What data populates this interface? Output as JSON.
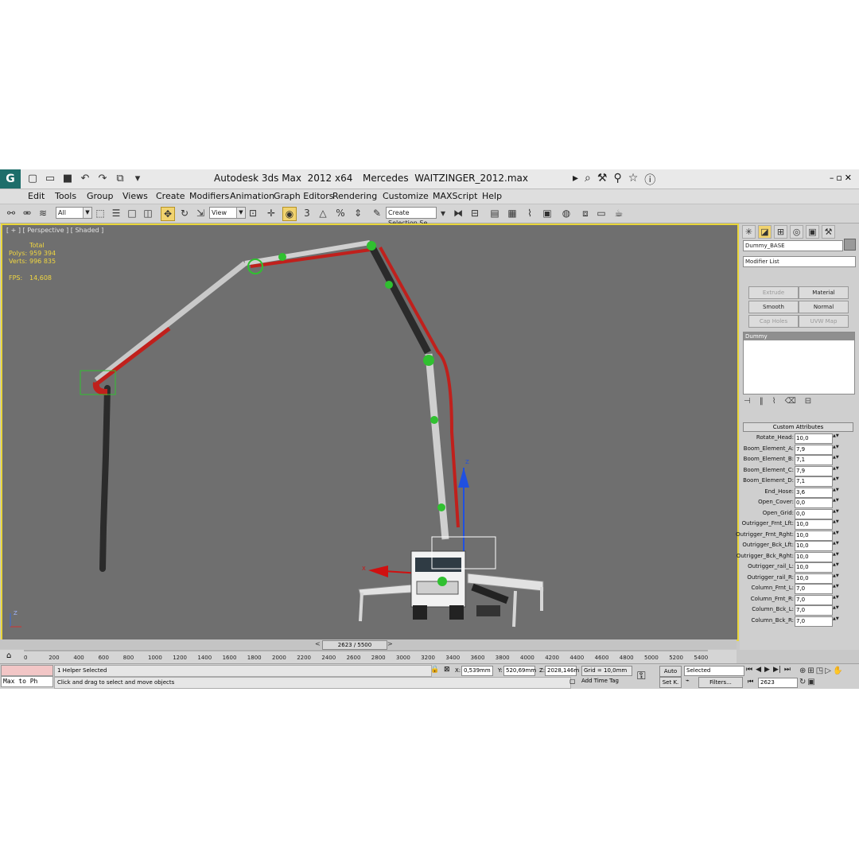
{
  "titlebar": {
    "app_title": "Autodesk 3ds Max  2012 x64",
    "file_title": "Mercedes  WAITZINGER_2012.max",
    "logo_icon": "3dsmax-logo-icon"
  },
  "menu": [
    "Edit",
    "Tools",
    "Group",
    "Views",
    "Create",
    "Modifiers",
    "Animation",
    "Graph Editors",
    "Rendering",
    "Customize",
    "MAXScript",
    "Help"
  ],
  "toolbar": {
    "filter_value": "All",
    "refcoord_value": "View",
    "selection_set_placeholder": "Create Selection Se"
  },
  "viewport": {
    "label": "[ + ] [ Perspective ] [ Shaded ]",
    "stats": {
      "total_label": "Total",
      "polys_label": "Polys:",
      "polys_value": "959 394",
      "verts_label": "Verts:",
      "verts_value": "996 835",
      "fps_label": "FPS:",
      "fps_value": "14,608"
    },
    "axis_z_label": "Z",
    "axis_x_label": "X",
    "corner_z": "Z"
  },
  "command_panel": {
    "object_name": "Dummy_BASE",
    "modifier_list": "Modifier List",
    "buttons": [
      {
        "label": "Extrude",
        "enabled": false
      },
      {
        "label": "Material",
        "enabled": true
      },
      {
        "label": "Smooth",
        "enabled": true
      },
      {
        "label": "Normal",
        "enabled": true
      },
      {
        "label": "Cap Holes",
        "enabled": false
      },
      {
        "label": "UVW Map",
        "enabled": false
      }
    ],
    "stack_item": "Dummy",
    "rollout_title": "Custom Attributes",
    "attributes": [
      {
        "label": "Rotate_Head:",
        "value": "10,0"
      },
      {
        "label": "Boom_Element_A:",
        "value": "7,9"
      },
      {
        "label": "Boom_Element_B:",
        "value": "7,1"
      },
      {
        "label": "Boom_Element_C:",
        "value": "7,9"
      },
      {
        "label": "Boom_Element_D:",
        "value": "7,1"
      },
      {
        "label": "End_Hose:",
        "value": "3,6"
      },
      {
        "label": "Open_Cover:",
        "value": "0,0"
      },
      {
        "label": "Open_Grid:",
        "value": "0,0"
      },
      {
        "label": "Outrigger_Frnt_Lft:",
        "value": "10,0"
      },
      {
        "label": "Outrigger_Frnt_Rght:",
        "value": "10,0"
      },
      {
        "label": "Outrigger_Bck_Lft:",
        "value": "10,0"
      },
      {
        "label": "Outrigger_Bck_Rght:",
        "value": "10,0"
      },
      {
        "label": "Outrigger_rail_L:",
        "value": "10,0"
      },
      {
        "label": "Outrigger_rail_R:",
        "value": "10,0"
      },
      {
        "label": "Column_Frnt_L:",
        "value": "7,0"
      },
      {
        "label": "Column_Frnt_R:",
        "value": "7,0"
      },
      {
        "label": "Column_Bck_L:",
        "value": "7,0"
      },
      {
        "label": "Column_Bck_R:",
        "value": "7,0"
      }
    ]
  },
  "timeline": {
    "slider_label": "2623 / 5500",
    "prev": "<",
    "next": ">",
    "ticks": [
      "0",
      "200",
      "400",
      "600",
      "800",
      "1000",
      "1200",
      "1400",
      "1600",
      "1800",
      "2000",
      "2200",
      "2400",
      "2600",
      "2800",
      "3000",
      "3200",
      "3400",
      "3600",
      "3800",
      "4000",
      "4200",
      "4400",
      "4600",
      "4800",
      "5000",
      "5200",
      "5400"
    ]
  },
  "status": {
    "maxscript": "Max to Ph",
    "selection_info": "1 Helper Selected",
    "prompt": "Click and drag to select and move objects",
    "x_label": "X:",
    "x_value": "0,539mm",
    "y_label": "Y:",
    "y_value": "520,69mm",
    "z_label": "Z:",
    "z_value": "2028,146m",
    "grid": "Grid = 10,0mm",
    "add_time_tag": "Add Time Tag",
    "auto_key": "Auto",
    "set_key": "Set K.",
    "key_filter_value": "Selected",
    "filters": "Filters...",
    "current_frame": "2623"
  }
}
